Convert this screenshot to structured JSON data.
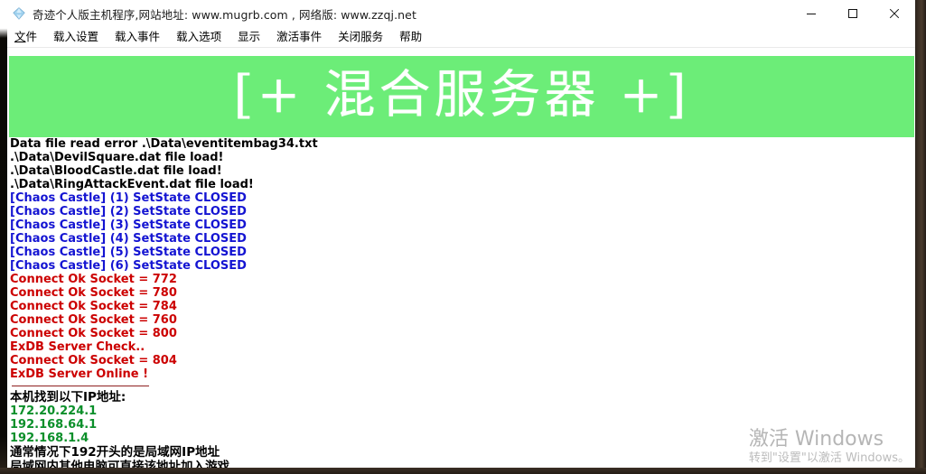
{
  "window": {
    "title": "奇迹个人版主机程序,网站地址: www.mugrb.com , 网络版: www.zzqj.net",
    "icon": "gem-diamond-icon",
    "controls": {
      "minimize": "minimize-icon",
      "maximize": "maximize-icon",
      "close": "close-icon"
    }
  },
  "menubar": {
    "items": [
      {
        "label": "文件",
        "accel": "文"
      },
      {
        "label": "载入设置",
        "accel": ""
      },
      {
        "label": "载入事件",
        "accel": ""
      },
      {
        "label": "载入选项",
        "accel": ""
      },
      {
        "label": "显示",
        "accel": ""
      },
      {
        "label": "激活事件",
        "accel": ""
      },
      {
        "label": "关闭服务",
        "accel": ""
      },
      {
        "label": "帮助",
        "accel": ""
      }
    ]
  },
  "banner": {
    "text": "[+ 混合服务器 +]",
    "background_color": "#6ced78",
    "text_color": "#ffffff"
  },
  "log": {
    "colors": {
      "black": "#000000",
      "blue": "#1414d2",
      "red": "#cc0000",
      "green": "#0b8f2a",
      "divider": "#8e2020"
    },
    "lines": [
      {
        "text": "Data file read error .\\Data\\eventitembag34.txt",
        "color": "black"
      },
      {
        "text": ".\\Data\\DevilSquare.dat file load!",
        "color": "black"
      },
      {
        "text": ".\\Data\\BloodCastle.dat file load!",
        "color": "black"
      },
      {
        "text": ".\\Data\\RingAttackEvent.dat file load!",
        "color": "black"
      },
      {
        "text": "[Chaos Castle] (1) SetState CLOSED",
        "color": "blue"
      },
      {
        "text": "[Chaos Castle] (2) SetState CLOSED",
        "color": "blue"
      },
      {
        "text": "[Chaos Castle] (3) SetState CLOSED",
        "color": "blue"
      },
      {
        "text": "[Chaos Castle] (4) SetState CLOSED",
        "color": "blue"
      },
      {
        "text": "[Chaos Castle] (5) SetState CLOSED",
        "color": "blue"
      },
      {
        "text": "[Chaos Castle] (6) SetState CLOSED",
        "color": "blue"
      },
      {
        "text": "Connect Ok Socket = 772",
        "color": "red"
      },
      {
        "text": "Connect Ok Socket = 780",
        "color": "red"
      },
      {
        "text": "Connect Ok Socket = 784",
        "color": "red"
      },
      {
        "text": "Connect Ok Socket = 760",
        "color": "red"
      },
      {
        "text": "Connect Ok Socket = 800",
        "color": "red"
      },
      {
        "text": "ExDB Server Check..",
        "color": "red"
      },
      {
        "text": "Connect Ok Socket = 804",
        "color": "red"
      },
      {
        "text": "ExDB Server Online !",
        "color": "red"
      }
    ],
    "ip_section": {
      "heading": "本机找到以下IP地址:",
      "addresses": [
        "172.20.224.1",
        "192.168.64.1",
        "192.168.1.4"
      ],
      "note_line1": "通常情况下192开头的是局域网IP地址",
      "note_line2": "局域网内其他电脑可直接该地址加入游戏"
    }
  },
  "watermark": {
    "title": "激活 Windows",
    "subtitle": "转到\"设置\"以激活 Windows。"
  }
}
